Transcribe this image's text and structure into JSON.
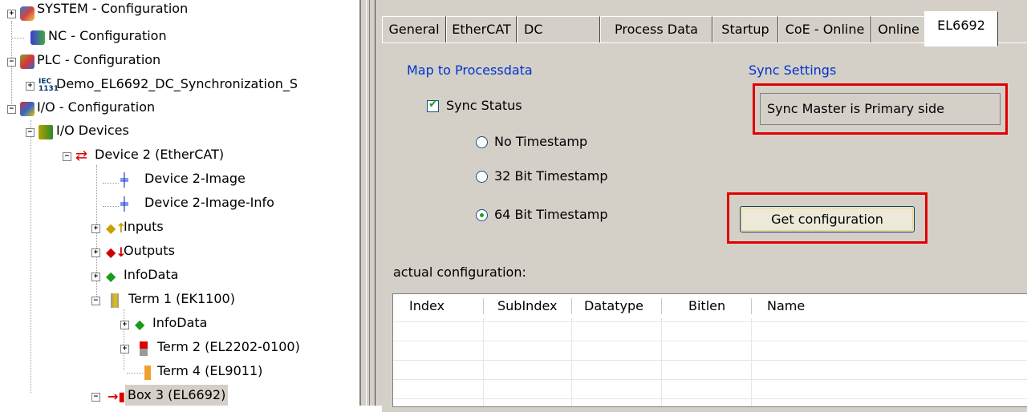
{
  "tree": {
    "items": [
      {
        "label": "SYSTEM - Configuration",
        "icon": "system-config-icon",
        "expander": "+"
      },
      {
        "label": "NC - Configuration",
        "icon": "nc-config-icon",
        "expander": ""
      },
      {
        "label": "PLC - Configuration",
        "icon": "plc-config-icon",
        "expander": "−"
      },
      {
        "label": "Demo_EL6692_DC_Synchronization_S",
        "icon": "iec-project-icon",
        "expander": "+"
      },
      {
        "label": "I/O - Configuration",
        "icon": "io-config-icon",
        "expander": "−"
      },
      {
        "label": "I/O Devices",
        "icon": "io-devices-icon",
        "expander": "−"
      },
      {
        "label": "Device 2 (EtherCAT)",
        "icon": "ethercat-device-icon",
        "expander": "−"
      },
      {
        "label": "Device 2-Image",
        "icon": "device-image-icon",
        "expander": ""
      },
      {
        "label": "Device 2-Image-Info",
        "icon": "device-image-info-icon",
        "expander": ""
      },
      {
        "label": "Inputs",
        "icon": "inputs-icon",
        "expander": "+"
      },
      {
        "label": "Outputs",
        "icon": "outputs-icon",
        "expander": "+"
      },
      {
        "label": "InfoData",
        "icon": "infodata-icon",
        "expander": "+"
      },
      {
        "label": "Term 1 (EK1100)",
        "icon": "terminal-coupler-icon",
        "expander": "−"
      },
      {
        "label": "InfoData",
        "icon": "infodata-icon",
        "expander": "+"
      },
      {
        "label": "Term 2 (EL2202-0100)",
        "icon": "terminal-output-icon",
        "expander": "+"
      },
      {
        "label": "Term 4 (EL9011)",
        "icon": "terminal-end-icon",
        "expander": ""
      },
      {
        "label": "Box 3 (EL6692)",
        "icon": "bridge-box-icon",
        "expander": "−"
      }
    ]
  },
  "tabs": [
    {
      "label": "General"
    },
    {
      "label": "EtherCAT"
    },
    {
      "label": "DC"
    },
    {
      "label": "Process Data"
    },
    {
      "label": "Startup"
    },
    {
      "label": "CoE - Online"
    },
    {
      "label": "Online"
    },
    {
      "label": "EL6692"
    }
  ],
  "map": {
    "title": "Map to Processdata",
    "sync_status_label": "Sync Status",
    "sync_status_checked": true,
    "options": [
      {
        "label": "No Timestamp",
        "selected": false
      },
      {
        "label": "32 Bit Timestamp",
        "selected": false
      },
      {
        "label": "64 Bit Timestamp",
        "selected": true
      }
    ]
  },
  "sync": {
    "title": "Sync Settings",
    "value": "Sync Master is Primary side",
    "button_label": "Get configuration"
  },
  "config": {
    "label": "actual configuration:",
    "columns": [
      "Index",
      "SubIndex",
      "Datatype",
      "Bitlen",
      "Name"
    ]
  },
  "colors": {
    "highlight": "#e00000",
    "group_title": "#0033cc",
    "dialog_bg": "#d4d0c8"
  }
}
